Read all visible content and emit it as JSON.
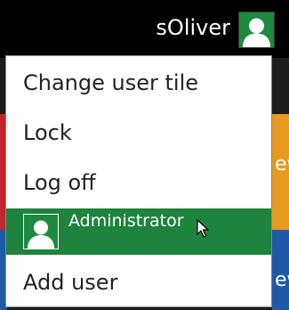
{
  "header": {
    "username": "sOliver",
    "avatar_icon": "user-silhouette-icon"
  },
  "menu": {
    "items": [
      {
        "label": "Change user tile"
      },
      {
        "label": "Lock"
      },
      {
        "label": "Log off"
      },
      {
        "label": "Administrator",
        "icon": "user-silhouette-icon",
        "highlighted": true
      },
      {
        "label": "Add user"
      }
    ]
  },
  "background_tiles": {
    "orange_tile_text": "ew",
    "blue_tile_text": "ew"
  },
  "colors": {
    "top_bar": "#000000",
    "accent_green": "#1d833d",
    "tile_red": "#c2272d",
    "tile_orange": "#e79a1f",
    "tile_blue": "#1f5aa8",
    "menu_bg": "#ffffff"
  }
}
